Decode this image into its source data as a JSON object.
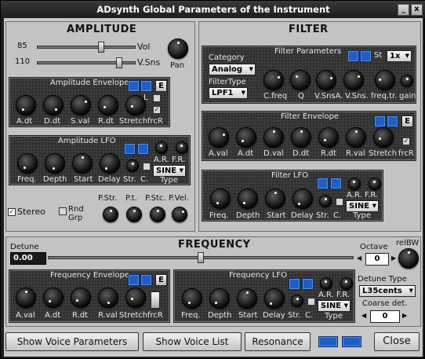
{
  "window": {
    "title": "ADsynth Global Parameters of the Instrument",
    "minimize": "_",
    "close": "x"
  },
  "amplitude": {
    "title": "AMPLITUDE",
    "vol": {
      "label": "Vol",
      "value": "85",
      "level": 0.67
    },
    "vsns": {
      "label": "V.Sns",
      "value": "110",
      "level": 0.86
    },
    "pan_label": "Pan",
    "envelope": {
      "title": "Amplitude Envelope",
      "edit": "E",
      "linear_label": "L",
      "knobs": [
        "A.dt",
        "D.dt",
        "S.val",
        "R.dt",
        "Stretch"
      ],
      "frcr_label": "frcR"
    },
    "lfo": {
      "title": "Amplitude LFO",
      "knobs": [
        "Freq.",
        "Depth",
        "Start",
        "Delay"
      ],
      "str_label": "Str.",
      "c_label": "C.",
      "ar_label": "A.R.",
      "fr_label": "F.R.",
      "type_value": "SINE",
      "type_label": "Type"
    },
    "stereo_label": "Stereo",
    "rnd_grp_label": "Rnd Grp",
    "bottom_knobs": [
      "P.Str.",
      "P.t.",
      "P.Stc.",
      "P.Vel."
    ]
  },
  "filter": {
    "title": "FILTER",
    "params": {
      "title": "Filter Parameters",
      "st_label": "St",
      "st_value": "1x",
      "category_label": "Category",
      "category_value": "Analog",
      "filtertype_label": "FilterType",
      "filtertype_value": "LPF1",
      "knobs": [
        "C.freq",
        "Q",
        "V.SnsA.",
        "V.Sns.",
        "freq.tr.",
        "gain"
      ]
    },
    "envelope": {
      "title": "Filter Envelope",
      "edit": "E",
      "knobs": [
        "A.val",
        "A.dt",
        "D.val",
        "D.dt",
        "R.dt",
        "R.val",
        "Stretch"
      ],
      "frcr_label": "frcR"
    },
    "lfo": {
      "title": "Filter LFO",
      "knobs": [
        "Freq.",
        "Depth",
        "Start",
        "Delay"
      ],
      "str_label": "Str.",
      "c_label": "C.",
      "ar_label": "A.R.",
      "fr_label": "F.R.",
      "type_value": "SINE",
      "type_label": "Type"
    }
  },
  "frequency": {
    "title": "FREQUENCY",
    "detune_label": "Detune",
    "detune_value": "0.00",
    "octave_label": "Octave",
    "octave_value": "0",
    "relbw_label": "relBW",
    "envelope": {
      "title": "Frequency Envelope",
      "edit": "E",
      "knobs": [
        "A.val",
        "A.dt",
        "R.dt",
        "R.val",
        "Stretch"
      ],
      "frcr_label": "frcR"
    },
    "lfo": {
      "title": "Frequency LFO",
      "knobs": [
        "Freq.",
        "Depth",
        "Start",
        "Delay"
      ],
      "str_label": "Str.",
      "c_label": "C.",
      "ar_label": "A.R.",
      "fr_label": "F.R.",
      "type_value": "SINE",
      "type_label": "Type"
    },
    "detune_type_label": "Detune Type",
    "detune_type_value": "L35cents",
    "coarse_label": "Coarse det.",
    "coarse_value": "0"
  },
  "buttons": {
    "show_voice_params": "Show Voice Parameters",
    "show_voice_list": "Show Voice List",
    "resonance": "Resonance",
    "close": "Close"
  },
  "colors": {
    "accent_blue": "#1f5fc4",
    "panel_bg": "#3a3a3a",
    "window_bg": "#c8c8c8"
  }
}
